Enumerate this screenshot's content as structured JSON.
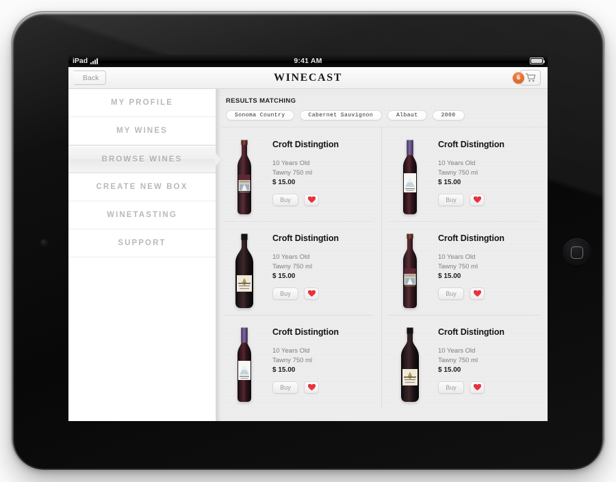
{
  "device": {
    "name": "iPad",
    "orientation": "landscape",
    "home_button": "home-button",
    "camera": "front-camera"
  },
  "statusbar": {
    "carrier": "iPad",
    "wifi_icon": "wifi-icon",
    "time": "9:41 AM",
    "battery_icon": "battery-full-icon"
  },
  "navbar": {
    "back_label": "Back",
    "title": "WINECAST",
    "cart_badge_count": "6",
    "cart_icon": "shopping-cart-icon"
  },
  "sidebar": {
    "items": [
      {
        "label": "MY PROFILE",
        "active": false
      },
      {
        "label": "MY WINES",
        "active": false
      },
      {
        "label": "BROWSE WINES",
        "active": true
      },
      {
        "label": "CREATE NEW BOX",
        "active": false
      },
      {
        "label": "WINETASTING",
        "active": false
      },
      {
        "label": "SUPPORT",
        "active": false
      }
    ]
  },
  "content": {
    "results_label": "RESULTS MATCHING",
    "filters": [
      {
        "label": "Sonoma Country"
      },
      {
        "label": "Cabernet Sauvignon"
      },
      {
        "label": "Albaut"
      },
      {
        "label": "2000"
      }
    ],
    "cards": [
      {
        "name": "Croft Distingtion",
        "age": "10 Years Old",
        "variety": "Tawny 750 ml",
        "price": "$ 15.00",
        "buy_label": "Buy",
        "fav_icon": "heart-icon",
        "bottle": "bordeaux-sailboat"
      },
      {
        "name": "Croft Distingtion",
        "age": "10 Years Old",
        "variety": "Tawny 750 ml",
        "price": "$ 15.00",
        "buy_label": "Buy",
        "fav_icon": "heart-icon",
        "bottle": "bordeaux-mountain-purple"
      },
      {
        "name": "Croft Distingtion",
        "age": "10 Years Old",
        "variety": "Tawny 750 ml",
        "price": "$ 15.00",
        "buy_label": "Buy",
        "fav_icon": "heart-icon",
        "bottle": "burgundy-cream"
      },
      {
        "name": "Croft Distingtion",
        "age": "10 Years Old",
        "variety": "Tawny 750 ml",
        "price": "$ 15.00",
        "buy_label": "Buy",
        "fav_icon": "heart-icon",
        "bottle": "bordeaux-sailboat"
      },
      {
        "name": "Croft Distingtion",
        "age": "10 Years Old",
        "variety": "Tawny 750 ml",
        "price": "$ 15.00",
        "buy_label": "Buy",
        "fav_icon": "heart-icon",
        "bottle": "bordeaux-mountain-purple"
      },
      {
        "name": "Croft Distingtion",
        "age": "10 Years Old",
        "variety": "Tawny 750 ml",
        "price": "$ 15.00",
        "buy_label": "Buy",
        "fav_icon": "heart-icon",
        "bottle": "burgundy-cream"
      }
    ]
  },
  "colors": {
    "badge_orange": "#e4712f",
    "heart_red": "#e8323c",
    "content_bg": "#ececec",
    "sidebar_text": "#b9b9b9",
    "title_black": "#1a1a1a"
  }
}
